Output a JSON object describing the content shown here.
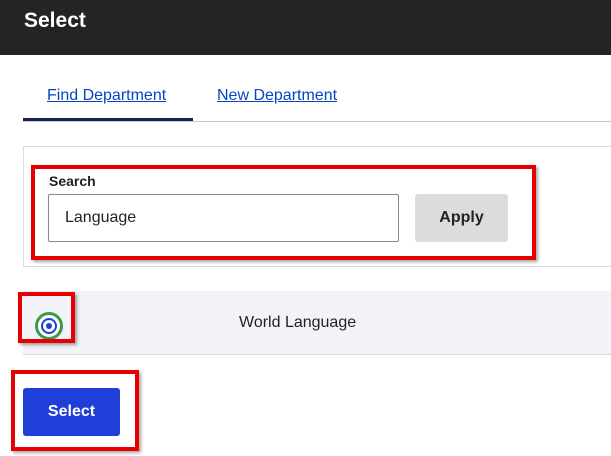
{
  "header": {
    "title": "Select"
  },
  "tabs": [
    {
      "label": "Find Department",
      "active": true
    },
    {
      "label": "New Department",
      "active": false
    }
  ],
  "search": {
    "label": "Search",
    "value": "Language",
    "apply_label": "Apply"
  },
  "results": [
    {
      "label": "World Language",
      "selected": true
    }
  ],
  "actions": {
    "select_label": "Select"
  },
  "colors": {
    "header_bg": "#232426",
    "link": "#0645c2",
    "primary": "#1f3fd9",
    "annotation": "#e60000"
  }
}
